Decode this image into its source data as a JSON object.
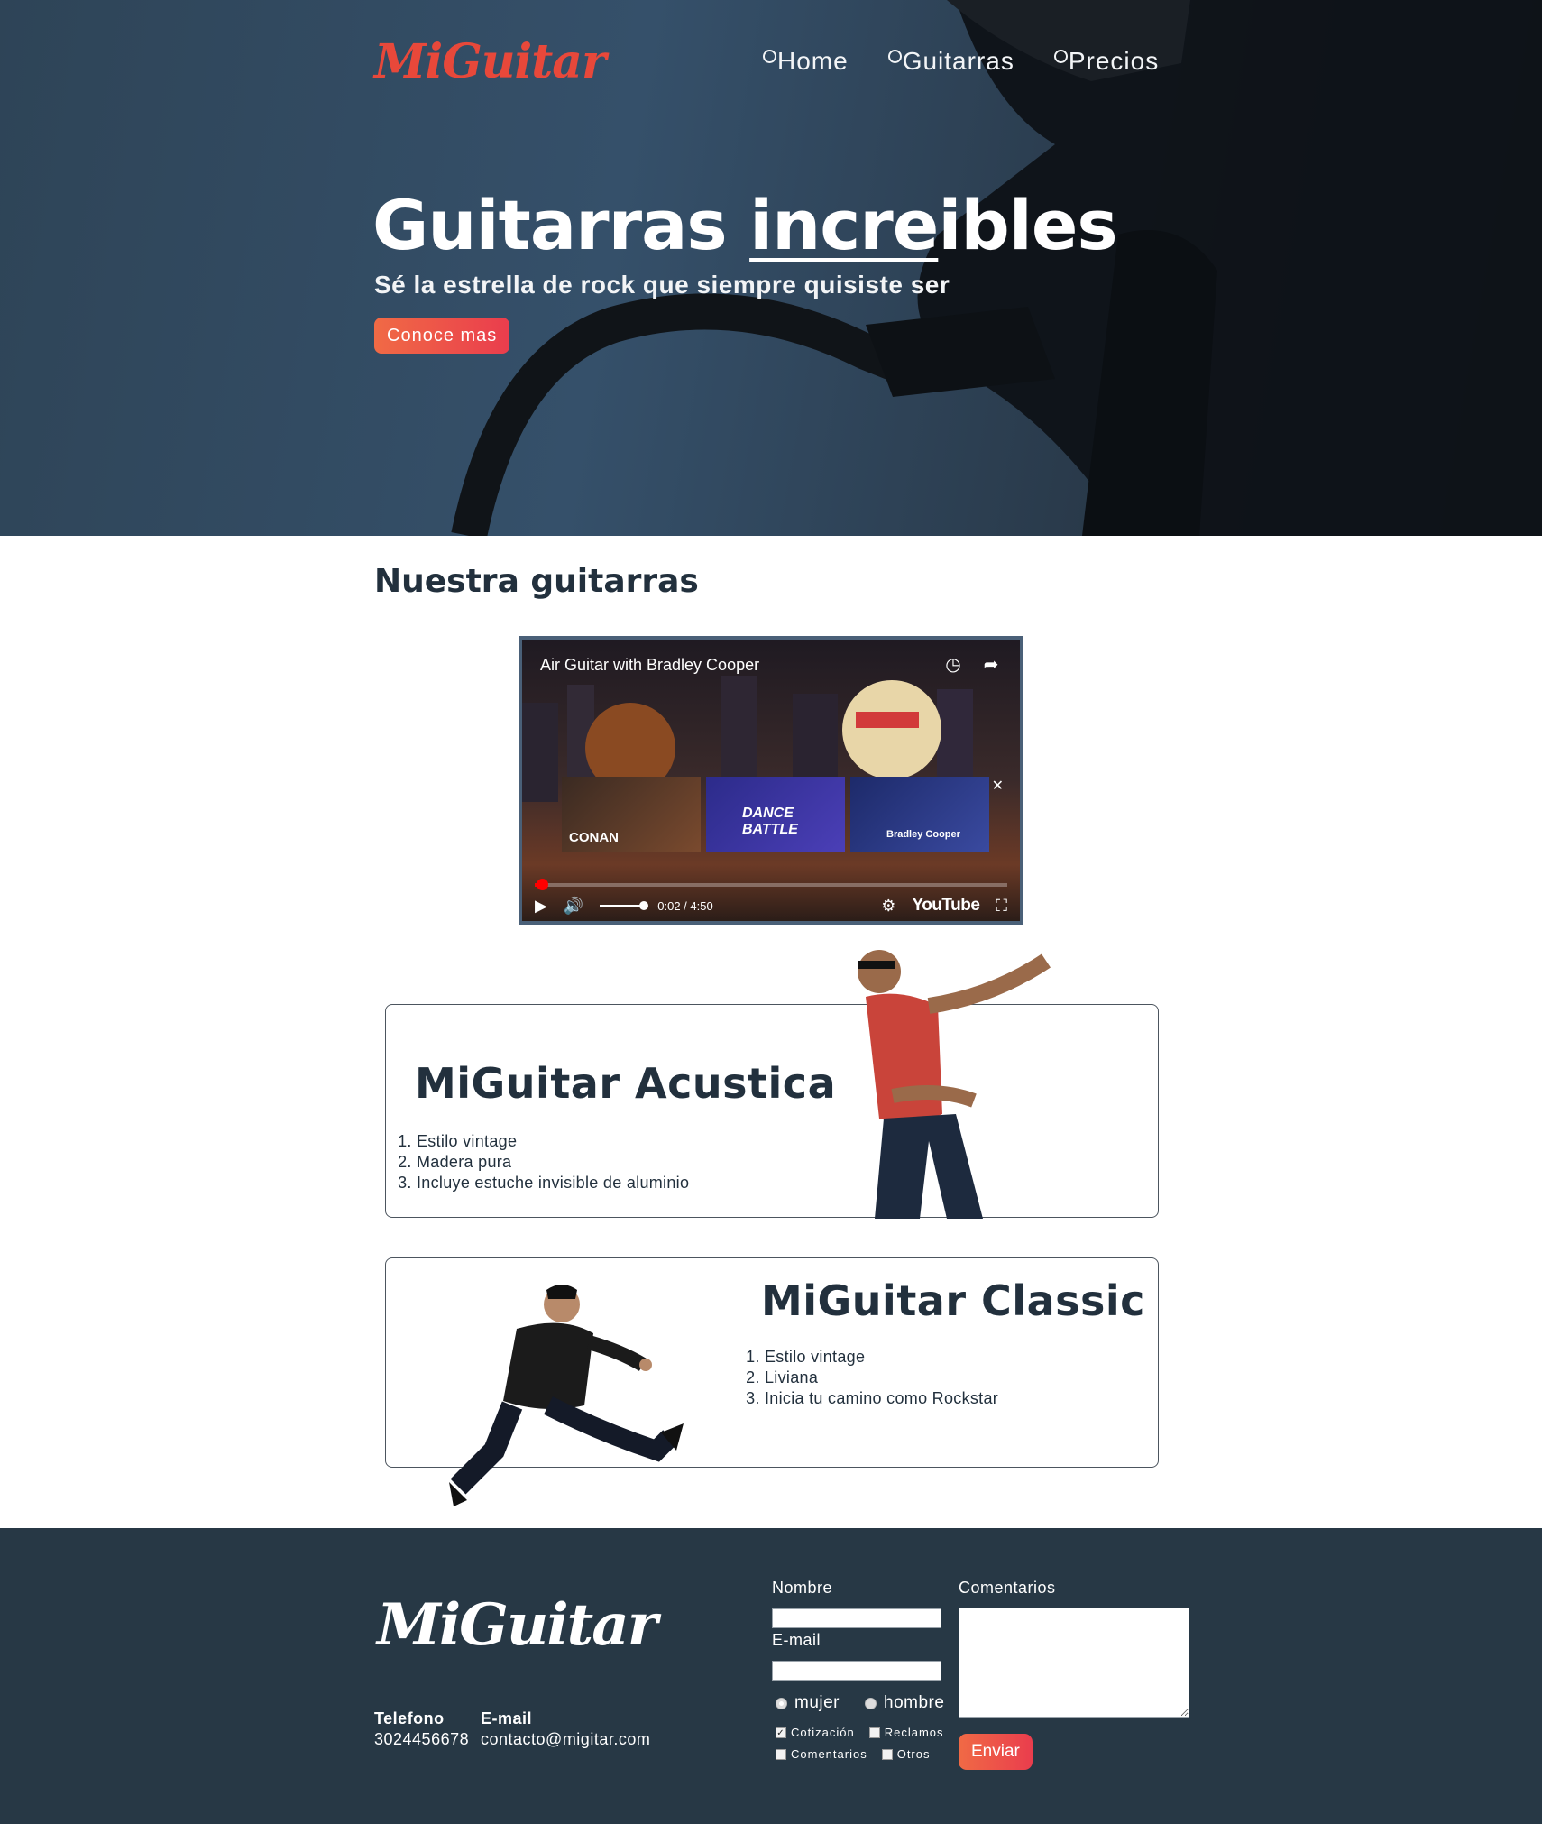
{
  "brand": {
    "logo_text": "MiGuitar",
    "accent": "#e8483a",
    "dark": "#22303d",
    "footer_bg": "#273845"
  },
  "nav": {
    "items": [
      {
        "label": "Home"
      },
      {
        "label": "Guitarras"
      },
      {
        "label": "Precios"
      }
    ]
  },
  "hero": {
    "title_start": "Guitarras ",
    "title_underlined": "incre",
    "title_end": "ibles",
    "subtitle": "Sé la estrella de rock que siempre quisiste ser",
    "cta_label": "Conoce mas"
  },
  "section": {
    "title": "Nuestra guitarras"
  },
  "video": {
    "title": "Air Guitar with Bradley Cooper",
    "time": "0:02 / 4:50",
    "progress": 0.01,
    "provider": "YouTube",
    "suggestions": [
      {
        "label": "CONAN"
      },
      {
        "label": "DANCE BATTLE"
      },
      {
        "label": "Bradley Cooper"
      }
    ],
    "icons": [
      "clock-icon",
      "share-icon",
      "play-icon",
      "volume-icon",
      "settings-icon",
      "fullscreen-icon",
      "close-icon"
    ]
  },
  "products": [
    {
      "name": "MiGuitar Acustica",
      "features": [
        "Estilo vintage",
        "Madera pura",
        "Incluye estuche invisible de aluminio"
      ]
    },
    {
      "name": "MiGuitar Classic",
      "features": [
        "Estilo vintage",
        "Liviana",
        "Inicia tu camino como Rockstar"
      ]
    }
  ],
  "footer": {
    "phone_label": "Telefono",
    "phone": "3024456678",
    "email_label": "E-mail",
    "email": "contacto@migitar.com",
    "form": {
      "name_label": "Nombre",
      "email_label": "E-mail",
      "comments_label": "Comentarios",
      "gender_options": [
        "mujer",
        "hombre"
      ],
      "checkbox_options": [
        "Cotización",
        "Reclamos",
        "Comentarios",
        "Otros"
      ],
      "submit_label": "Enviar"
    }
  }
}
